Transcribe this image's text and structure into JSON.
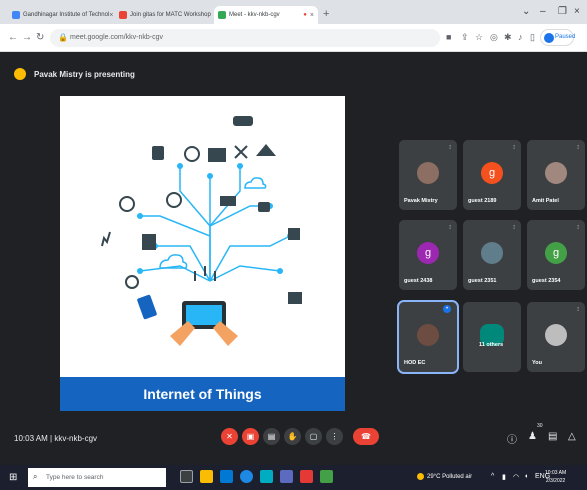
{
  "browser": {
    "tabs": [
      {
        "title": "Gandhinagar Institute of Technol",
        "favicon_color": "#4285f4",
        "active": false
      },
      {
        "title": "Join gitas for MATC Workshop",
        "favicon_color": "#ea4335",
        "active": false
      },
      {
        "title": "Meet - kkv-nkb-cgv",
        "favicon_color": "#34a853",
        "active": true
      }
    ],
    "url": "meet.google.com/kkv-nkb-cgv",
    "profile_label": "Paused"
  },
  "meet": {
    "presenting_text": "Pavak Mistry is presenting",
    "slide_title": "Internet of Things",
    "participants": [
      {
        "name": "Pavak Mistry",
        "initial": "",
        "color": "#8d6e63"
      },
      {
        "name": "guest 2189",
        "initial": "g",
        "color": "#f4511e"
      },
      {
        "name": "Amit Patel",
        "initial": "",
        "color": "#a1887f"
      },
      {
        "name": "guest 2438",
        "initial": "g",
        "color": "#9c27b0"
      },
      {
        "name": "guest 2351",
        "initial": "",
        "color": "#607d8b"
      },
      {
        "name": "guest 2354",
        "initial": "g",
        "color": "#43a047"
      },
      {
        "name": "HOD EC",
        "initial": "",
        "color": "#6d4c41"
      },
      {
        "name": "11 others",
        "initial": "",
        "color": "#00897b"
      },
      {
        "name": "You",
        "initial": "",
        "color": "#bdbdbd"
      }
    ],
    "time": "10:03 AM",
    "meeting_code": "kkv-nkb-cgv",
    "people_count": "30"
  },
  "taskbar": {
    "search_placeholder": "Type here to search",
    "weather": "29°C Polluted air",
    "clock_time": "10:03 AM",
    "clock_date": "2/3/2022"
  }
}
